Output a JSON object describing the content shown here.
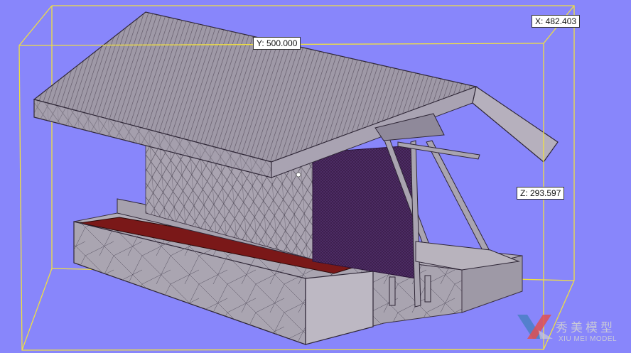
{
  "viewer": {
    "background_color": "#8886fb",
    "bbox_color": "#f0e040",
    "dimensions": {
      "x": "X: 482.403",
      "y": "Y: 500.000",
      "z": "Z: 293.597"
    }
  },
  "model": {
    "surface_color": "#a9a4b0",
    "mesh_line_color": "#3a3040",
    "slab_top_color": "#7a1818",
    "lattice_color": "#3b1d4a"
  },
  "watermark": {
    "chinese": "秀美模型",
    "english": "XIU MEI MODEL",
    "logo_icon": "xm-logo-icon"
  }
}
